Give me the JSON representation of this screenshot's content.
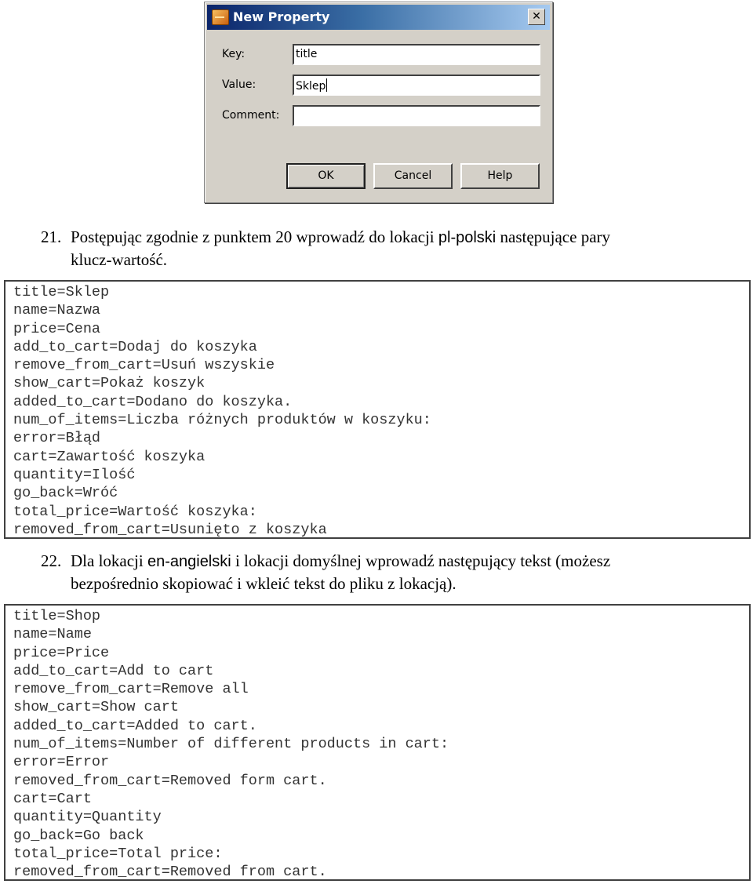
{
  "dialog": {
    "title": "New Property",
    "icon": "property-app-icon",
    "close_label": "✕",
    "fields": [
      {
        "label": "Key:",
        "value": "title",
        "placeholder": ""
      },
      {
        "label": "Value:",
        "value": "Sklep",
        "placeholder": ""
      },
      {
        "label": "Comment:",
        "value": "",
        "placeholder": ""
      }
    ],
    "buttons": {
      "ok": "OK",
      "cancel": "Cancel",
      "help": "Help"
    }
  },
  "step21": {
    "number": "21.",
    "text_before": "Postępując zgodnie z punktem 20 wprowadź do lokacji ",
    "locale": "pl-polski",
    "text_after": " następujące pary",
    "line2": "klucz-wartość."
  },
  "code_pl": [
    "title=Sklep",
    "name=Nazwa",
    "price=Cena",
    "add_to_cart=Dodaj do koszyka",
    "remove_from_cart=Usuń wszyskie",
    "show_cart=Pokaż koszyk",
    "added_to_cart=Dodano do koszyka.",
    "num_of_items=Liczba różnych produktów w koszyku:",
    "error=Błąd",
    "cart=Zawartość koszyka",
    "quantity=Ilość",
    "go_back=Wróć",
    "total_price=Wartość koszyka:",
    "removed_from_cart=Usunięto z koszyka"
  ],
  "step22": {
    "number": "22.",
    "text_before": "Dla lokacji ",
    "locale": "en-angielski",
    "text_after": " i lokacji domyślnej wprowadź następujący tekst (możesz",
    "line2": "bezpośrednio skopiować i wkleić tekst do pliku z lokacją)."
  },
  "code_en": [
    "title=Shop",
    "name=Name",
    "price=Price",
    "add_to_cart=Add to cart",
    "remove_from_cart=Remove all",
    "show_cart=Show cart",
    "added_to_cart=Added to cart.",
    "num_of_items=Number of different products in cart:",
    "error=Error",
    "removed_from_cart=Removed form cart.",
    "cart=Cart",
    "quantity=Quantity",
    "go_back=Go back",
    "total_price=Total price:",
    "removed_from_cart=Removed from cart."
  ]
}
